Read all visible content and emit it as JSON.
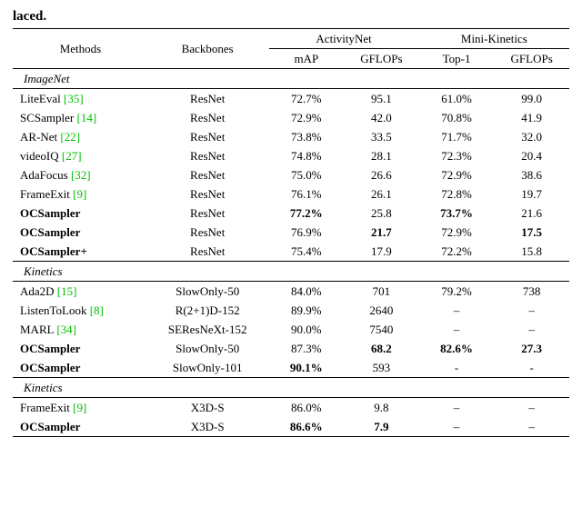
{
  "truncated_word": "laced",
  "header": {
    "methods": "Methods",
    "backbones": "Backbones",
    "activitynet": "ActivityNet",
    "minikinetics": "Mini-Kinetics",
    "map": "mAP",
    "gflops1": "GFLOPs",
    "top1": "Top-1",
    "gflops2": "GFLOPs"
  },
  "group_labels": {
    "imagenet": "ImageNet",
    "kinetics1": "Kinetics",
    "kinetics2": "Kinetics"
  },
  "imagenet": [
    {
      "method": "LiteEval",
      "cite": "[35]",
      "bold": false,
      "backbone": "ResNet",
      "map": "72.7%",
      "gf1": "95.1",
      "top1": "61.0%",
      "gf2": "99.0",
      "map_b": false,
      "gf1_b": false,
      "top1_b": false,
      "gf2_b": false
    },
    {
      "method": "SCSampler",
      "cite": "[14]",
      "bold": false,
      "backbone": "ResNet",
      "map": "72.9%",
      "gf1": "42.0",
      "top1": "70.8%",
      "gf2": "41.9",
      "map_b": false,
      "gf1_b": false,
      "top1_b": false,
      "gf2_b": false
    },
    {
      "method": "AR-Net",
      "cite": "[22]",
      "bold": false,
      "backbone": "ResNet",
      "map": "73.8%",
      "gf1": "33.5",
      "top1": "71.7%",
      "gf2": "32.0",
      "map_b": false,
      "gf1_b": false,
      "top1_b": false,
      "gf2_b": false
    },
    {
      "method": "videoIQ",
      "cite": "[27]",
      "bold": false,
      "backbone": "ResNet",
      "map": "74.8%",
      "gf1": "28.1",
      "top1": "72.3%",
      "gf2": "20.4",
      "map_b": false,
      "gf1_b": false,
      "top1_b": false,
      "gf2_b": false
    },
    {
      "method": "AdaFocus",
      "cite": "[32]",
      "bold": false,
      "backbone": "ResNet",
      "map": "75.0%",
      "gf1": "26.6",
      "top1": "72.9%",
      "gf2": "38.6",
      "map_b": false,
      "gf1_b": false,
      "top1_b": false,
      "gf2_b": false
    },
    {
      "method": "FrameExit",
      "cite": "[9]",
      "bold": false,
      "backbone": "ResNet",
      "map": "76.1%",
      "gf1": "26.1",
      "top1": "72.8%",
      "gf2": "19.7",
      "map_b": false,
      "gf1_b": false,
      "top1_b": false,
      "gf2_b": false
    },
    {
      "method": "OCSampler",
      "cite": "",
      "bold": true,
      "backbone": "ResNet",
      "map": "77.2%",
      "gf1": "25.8",
      "top1": "73.7%",
      "gf2": "21.6",
      "map_b": true,
      "gf1_b": false,
      "top1_b": true,
      "gf2_b": false
    },
    {
      "method": "OCSampler",
      "cite": "",
      "bold": true,
      "backbone": "ResNet",
      "map": "76.9%",
      "gf1": "21.7",
      "top1": "72.9%",
      "gf2": "17.5",
      "map_b": false,
      "gf1_b": true,
      "top1_b": false,
      "gf2_b": true
    },
    {
      "method": "OCSampler+",
      "cite": "",
      "bold": true,
      "backbone": "ResNet",
      "map": "75.4%",
      "gf1": "17.9",
      "top1": "72.2%",
      "gf2": "15.8",
      "map_b": false,
      "gf1_b": false,
      "top1_b": false,
      "gf2_b": false
    }
  ],
  "kinetics1": [
    {
      "method": "Ada2D",
      "cite": "[15]",
      "bold": false,
      "backbone": "SlowOnly-50",
      "map": "84.0%",
      "gf1": "701",
      "top1": "79.2%",
      "gf2": "738",
      "map_b": false,
      "gf1_b": false,
      "top1_b": false,
      "gf2_b": false
    },
    {
      "method": "ListenToLook",
      "cite": "[8]",
      "bold": false,
      "backbone": "R(2+1)D-152",
      "map": "89.9%",
      "gf1": "2640",
      "top1": "–",
      "gf2": "–",
      "map_b": false,
      "gf1_b": false,
      "top1_b": false,
      "gf2_b": false
    },
    {
      "method": "MARL",
      "cite": "[34]",
      "bold": false,
      "backbone": "SEResNeXt-152",
      "map": "90.0%",
      "gf1": "7540",
      "top1": "–",
      "gf2": "–",
      "map_b": false,
      "gf1_b": false,
      "top1_b": false,
      "gf2_b": false
    },
    {
      "method": "OCSampler",
      "cite": "",
      "bold": true,
      "backbone": "SlowOnly-50",
      "map": "87.3%",
      "gf1": "68.2",
      "top1": "82.6%",
      "gf2": "27.3",
      "map_b": false,
      "gf1_b": true,
      "top1_b": true,
      "gf2_b": true
    },
    {
      "method": "OCSampler",
      "cite": "",
      "bold": true,
      "backbone": "SlowOnly-101",
      "map": "90.1%",
      "gf1": "593",
      "top1": "-",
      "gf2": "-",
      "map_b": true,
      "gf1_b": false,
      "top1_b": false,
      "gf2_b": false
    }
  ],
  "kinetics2": [
    {
      "method": "FrameExit",
      "cite": "[9]",
      "bold": false,
      "backbone": "X3D-S",
      "map": "86.0%",
      "gf1": "9.8",
      "top1": "–",
      "gf2": "–",
      "map_b": false,
      "gf1_b": false,
      "top1_b": false,
      "gf2_b": false
    },
    {
      "method": "OCSampler",
      "cite": "",
      "bold": true,
      "backbone": "X3D-S",
      "map": "86.6%",
      "gf1": "7.9",
      "top1": "–",
      "gf2": "–",
      "map_b": true,
      "gf1_b": true,
      "top1_b": false,
      "gf2_b": false
    }
  ]
}
